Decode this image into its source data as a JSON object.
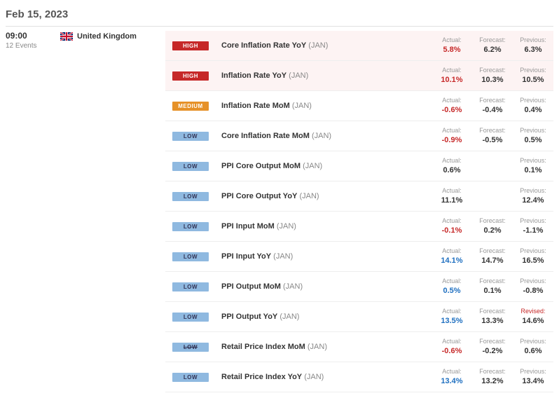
{
  "date": "Feb 15, 2023",
  "time": "09:00",
  "event_count_label": "12 Events",
  "country": "United Kingdom",
  "labels": {
    "actual": "Actual:",
    "forecast": "Forecast:",
    "previous": "Previous:",
    "revised": "Revised:"
  },
  "events": [
    {
      "impact": "HIGH",
      "impact_class": "high",
      "tint": true,
      "name": "Core Inflation Rate YoY",
      "period": "(JAN)",
      "actual": "5.8%",
      "actual_class": "v-red",
      "forecast": "6.2%",
      "previous": "6.3%",
      "prev_revised": false
    },
    {
      "impact": "HIGH",
      "impact_class": "high",
      "tint": true,
      "name": "Inflation Rate YoY",
      "period": "(JAN)",
      "actual": "10.1%",
      "actual_class": "v-red",
      "forecast": "10.3%",
      "previous": "10.5%",
      "prev_revised": false
    },
    {
      "impact": "MEDIUM",
      "impact_class": "medium",
      "tint": false,
      "name": "Inflation Rate MoM",
      "period": "(JAN)",
      "actual": "-0.6%",
      "actual_class": "v-red",
      "forecast": "-0.4%",
      "previous": "0.4%",
      "prev_revised": false
    },
    {
      "impact": "LOW",
      "impact_class": "low",
      "tint": false,
      "name": "Core Inflation Rate MoM",
      "period": "(JAN)",
      "actual": "-0.9%",
      "actual_class": "v-red",
      "forecast": "-0.5%",
      "previous": "0.5%",
      "prev_revised": false
    },
    {
      "impact": "LOW",
      "impact_class": "low",
      "tint": false,
      "name": "PPI Core Output MoM",
      "period": "(JAN)",
      "actual": "0.6%",
      "actual_class": "v-black",
      "forecast": "",
      "previous": "0.1%",
      "prev_revised": false
    },
    {
      "impact": "LOW",
      "impact_class": "low",
      "tint": false,
      "name": "PPI Core Output YoY",
      "period": "(JAN)",
      "actual": "11.1%",
      "actual_class": "v-black",
      "forecast": "",
      "previous": "12.4%",
      "prev_revised": false
    },
    {
      "impact": "LOW",
      "impact_class": "low",
      "tint": false,
      "name": "PPI Input MoM",
      "period": "(JAN)",
      "actual": "-0.1%",
      "actual_class": "v-red",
      "forecast": "0.2%",
      "previous": "-1.1%",
      "prev_revised": false
    },
    {
      "impact": "LOW",
      "impact_class": "low",
      "tint": false,
      "name": "PPI Input YoY",
      "period": "(JAN)",
      "actual": "14.1%",
      "actual_class": "v-blue",
      "forecast": "14.7%",
      "previous": "16.5%",
      "prev_revised": false
    },
    {
      "impact": "LOW",
      "impact_class": "low",
      "tint": false,
      "name": "PPI Output MoM",
      "period": "(JAN)",
      "actual": "0.5%",
      "actual_class": "v-blue",
      "forecast": "0.1%",
      "previous": "-0.8%",
      "prev_revised": false
    },
    {
      "impact": "LOW",
      "impact_class": "low",
      "tint": false,
      "name": "PPI Output YoY",
      "period": "(JAN)",
      "actual": "13.5%",
      "actual_class": "v-blue",
      "forecast": "13.3%",
      "previous": "14.6%",
      "prev_revised": true
    },
    {
      "impact": "LOW",
      "impact_class": "low strike",
      "tint": false,
      "name": "Retail Price Index MoM",
      "period": "(JAN)",
      "actual": "-0.6%",
      "actual_class": "v-red",
      "forecast": "-0.2%",
      "previous": "0.6%",
      "prev_revised": false
    },
    {
      "impact": "LOW",
      "impact_class": "low",
      "tint": false,
      "name": "Retail Price Index YoY",
      "period": "(JAN)",
      "actual": "13.4%",
      "actual_class": "v-blue",
      "forecast": "13.2%",
      "previous": "13.4%",
      "prev_revised": false
    }
  ]
}
